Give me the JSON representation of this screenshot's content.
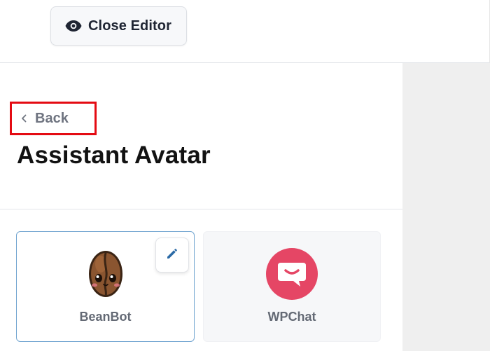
{
  "toolbar": {
    "close_editor_label": "Close Editor",
    "close_editor_icon": "eye-icon"
  },
  "panel": {
    "back_label": "Back",
    "back_icon": "chevron-left-icon",
    "title": "Assistant Avatar",
    "avatars": [
      {
        "name": "BeanBot",
        "icon": "coffee-bean-avatar-icon",
        "selected": true,
        "edit_icon": "pencil-icon"
      },
      {
        "name": "WPChat",
        "icon": "chat-bubble-smile-icon",
        "selected": false
      }
    ]
  },
  "colors": {
    "selected_border": "#73a6d1",
    "highlight_box": "#e40b13",
    "wpchat_brand": "#e54665",
    "edit_icon": "#2b6aa6"
  }
}
